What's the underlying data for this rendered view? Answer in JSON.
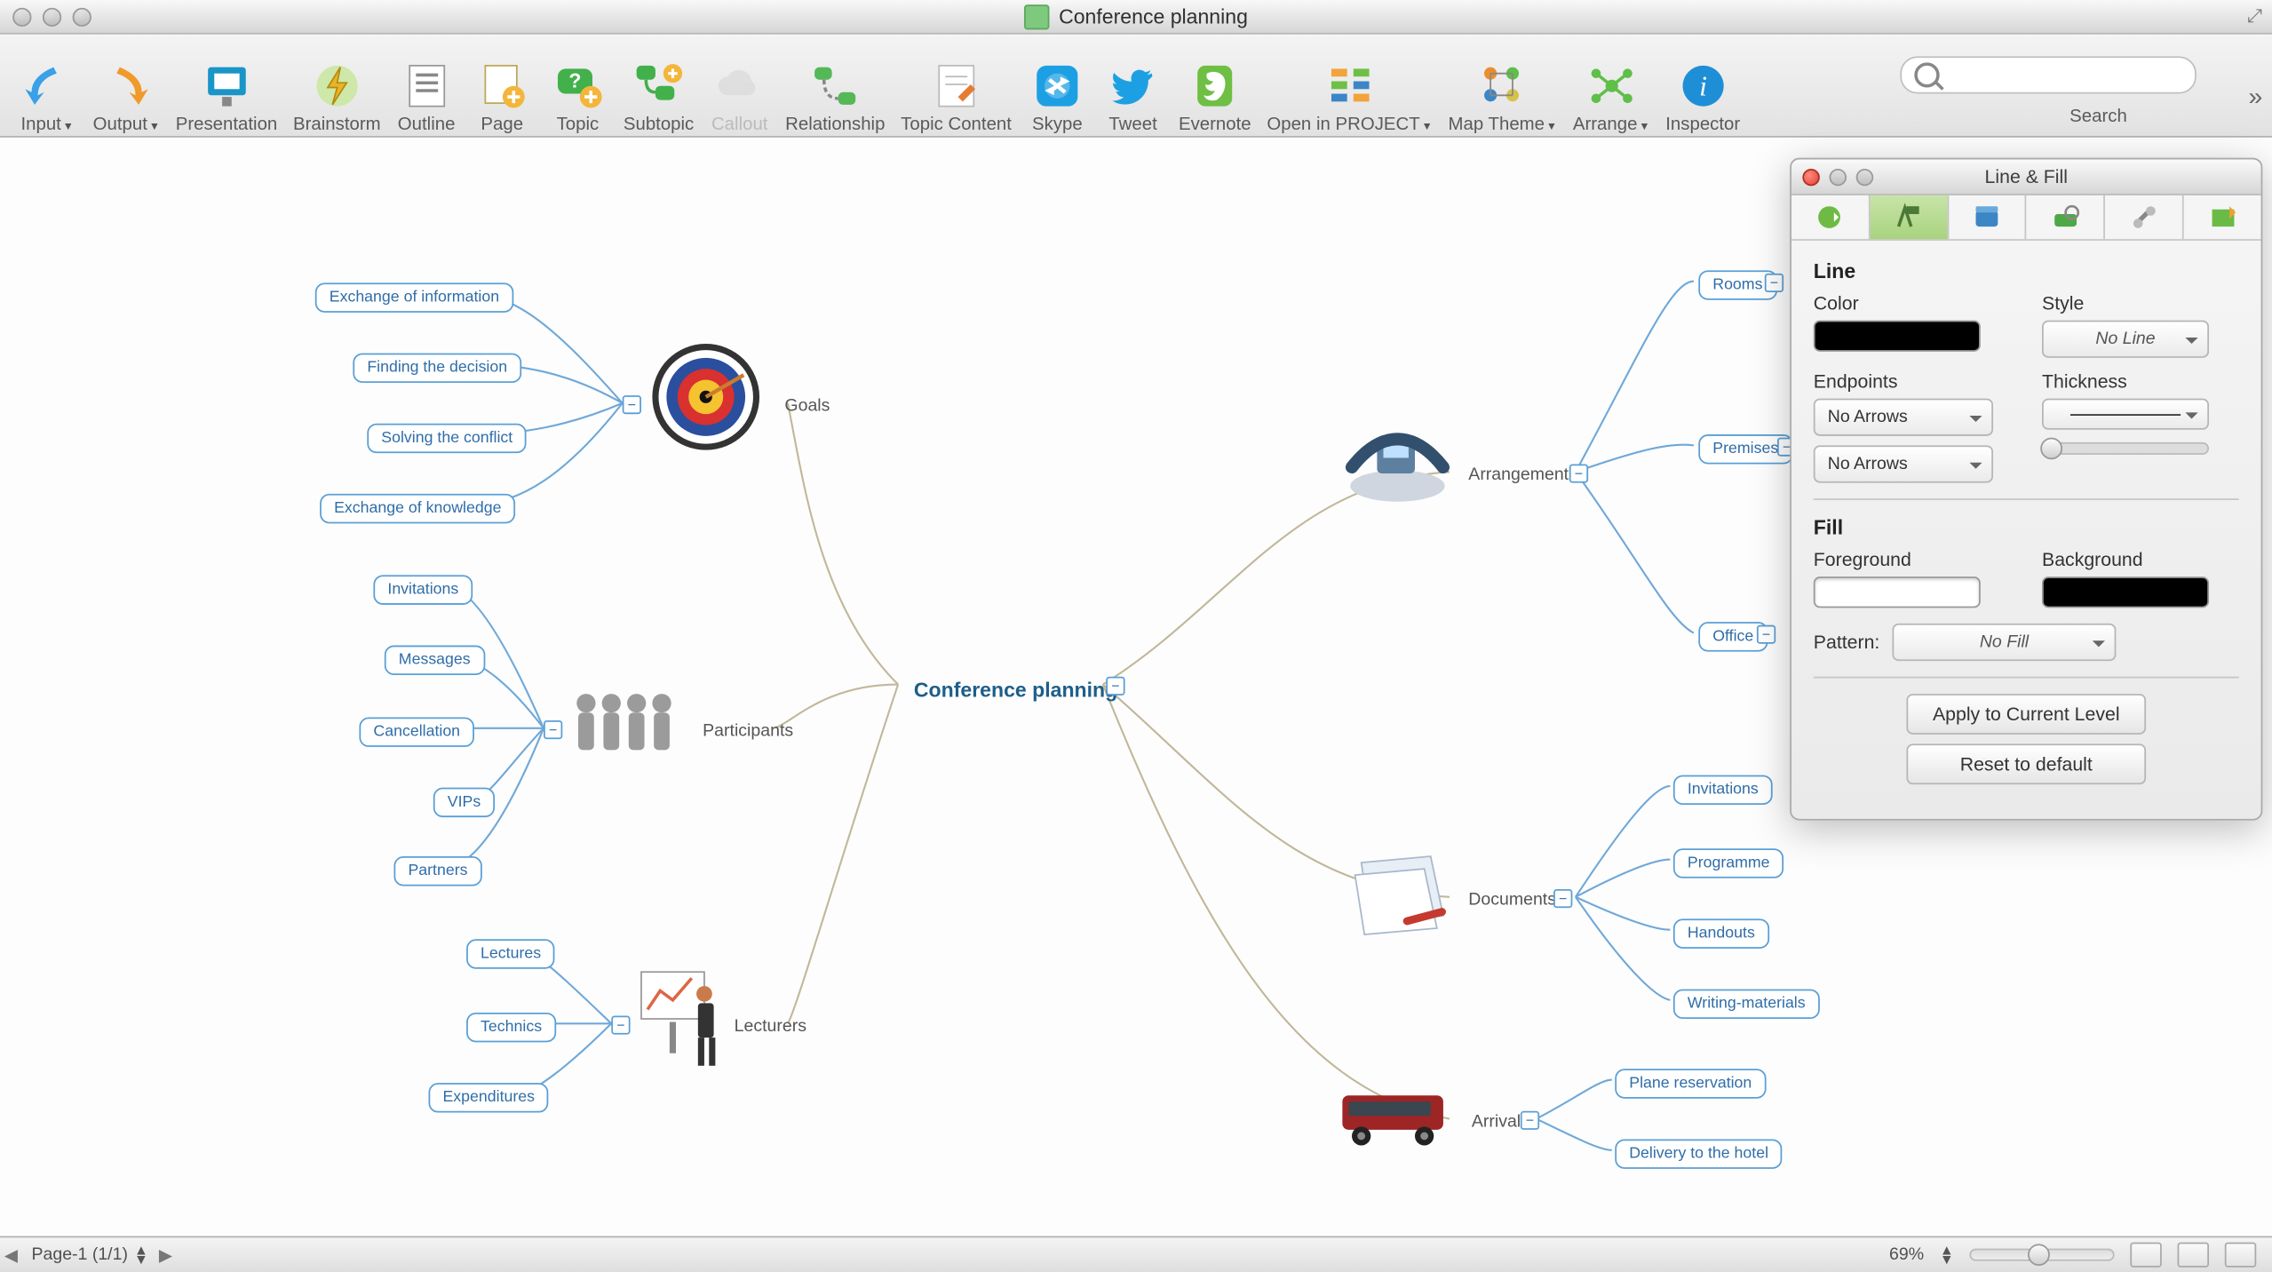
{
  "window_title": "Conference planning",
  "toolbar": [
    {
      "name": "input",
      "label": "Input",
      "icon": "arrow-in",
      "dropdown": true,
      "color": "#3aa0e8"
    },
    {
      "name": "output",
      "label": "Output",
      "icon": "arrow-out",
      "dropdown": true,
      "color": "#f09a2a"
    },
    {
      "name": "presentation",
      "label": "Presentation",
      "icon": "screen",
      "color": "#1995c7"
    },
    {
      "name": "brainstorm",
      "label": "Brainstorm",
      "icon": "bolt",
      "color": "#7dc341"
    },
    {
      "name": "outline",
      "label": "Outline",
      "icon": "outline",
      "color": "#8a8a8a"
    },
    {
      "name": "page",
      "label": "Page",
      "icon": "page-add",
      "color": "#f7b73b"
    },
    {
      "name": "topic",
      "label": "Topic",
      "icon": "topic-add",
      "color": "#42b04b"
    },
    {
      "name": "subtopic",
      "label": "Subtopic",
      "icon": "subtopic-add",
      "color": "#42b04b"
    },
    {
      "name": "callout",
      "label": "Callout",
      "icon": "cloud",
      "color": "#9e9e9e",
      "disabled": true
    },
    {
      "name": "relationship",
      "label": "Relationship",
      "icon": "rel",
      "color": "#55b857"
    },
    {
      "name": "topic-content",
      "label": "Topic Content",
      "icon": "note",
      "color": "#e67c32"
    },
    {
      "name": "skype",
      "label": "Skype",
      "icon": "skype",
      "color": "#1da0e3"
    },
    {
      "name": "tweet",
      "label": "Tweet",
      "icon": "twitter",
      "color": "#1da0e3"
    },
    {
      "name": "evernote",
      "label": "Evernote",
      "icon": "evernote",
      "color": "#6fbf44"
    },
    {
      "name": "open-in-project",
      "label": "Open in PROJECT",
      "icon": "project",
      "dropdown": true,
      "color": "#f2a33c"
    },
    {
      "name": "map-theme",
      "label": "Map Theme",
      "icon": "theme",
      "dropdown": true,
      "color": "#ec8d2e"
    },
    {
      "name": "arrange",
      "label": "Arrange",
      "icon": "arrange",
      "dropdown": true,
      "color": "#5fbf49"
    },
    {
      "name": "inspector",
      "label": "Inspector",
      "icon": "info",
      "color": "#1e8fd6"
    }
  ],
  "search_label": "Search",
  "mindmap": {
    "center": "Conference planning",
    "topics": {
      "goals": {
        "label": "Goals",
        "children": [
          "Exchange of information",
          "Finding the decision",
          "Solving the conflict",
          "Exchange of knowledge"
        ]
      },
      "participants": {
        "label": "Participants",
        "children": [
          "Invitations",
          "Messages",
          "Cancellation",
          "VIPs",
          "Partners"
        ]
      },
      "lecturers": {
        "label": "Lecturers",
        "children": [
          "Lectures",
          "Technics",
          "Expenditures"
        ]
      },
      "arrangement": {
        "label": "Arrangement",
        "children": [
          "Rooms",
          "Premises",
          "Office"
        ]
      },
      "documents": {
        "label": "Documents",
        "children": [
          "Invitations",
          "Programme",
          "Handouts",
          "Writing-materials"
        ]
      },
      "arrival": {
        "label": "Arrival",
        "children": [
          "Plane reservation",
          "Delivery to the hotel"
        ]
      }
    }
  },
  "inspector": {
    "title": "Line & Fill",
    "line": {
      "section": "Line",
      "color_label": "Color",
      "color_value": "#000000",
      "style_label": "Style",
      "style_value": "No Line",
      "endpoints_label": "Endpoints",
      "endpoint_start": "No Arrows",
      "endpoint_end": "No Arrows",
      "thickness_label": "Thickness"
    },
    "fill": {
      "section": "Fill",
      "foreground_label": "Foreground",
      "foreground_value": "#ffffff",
      "background_label": "Background",
      "background_value": "#000000",
      "pattern_label": "Pattern:",
      "pattern_value": "No Fill"
    },
    "apply_button": "Apply to Current Level",
    "reset_button": "Reset to default"
  },
  "statusbar": {
    "page_label": "Page-1 (1/1)",
    "zoom": "69%"
  }
}
